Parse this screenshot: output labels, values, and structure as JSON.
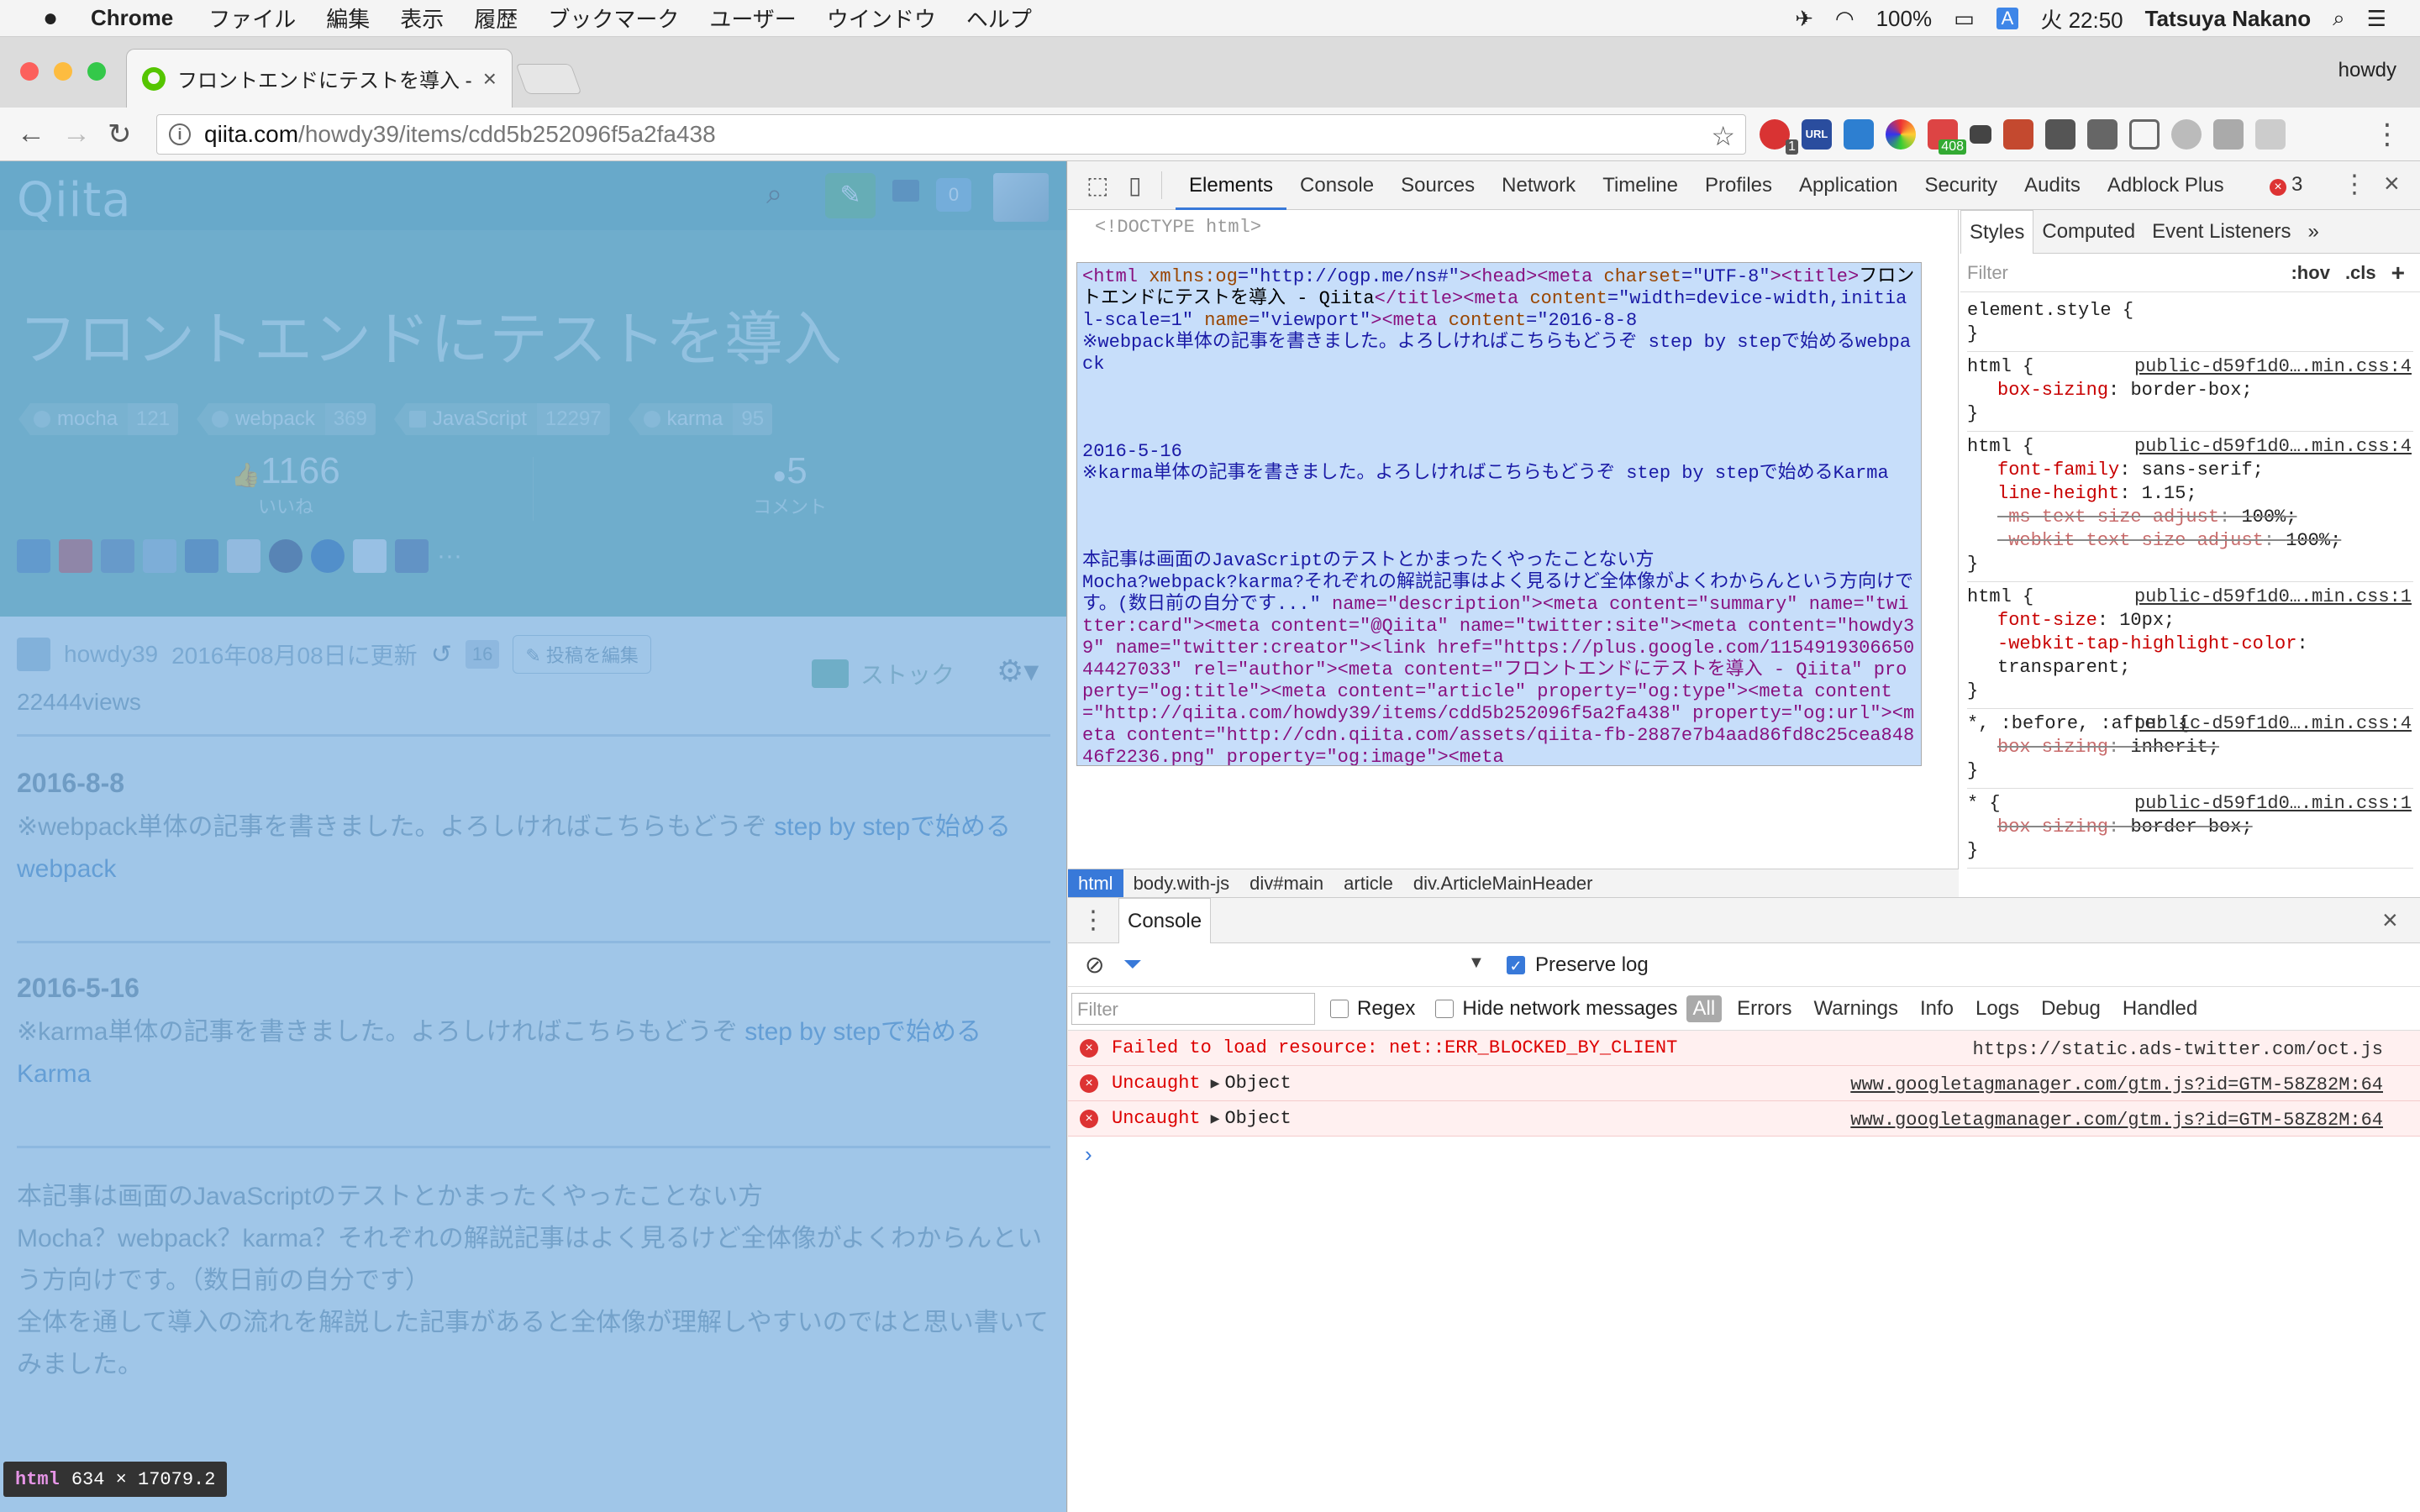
{
  "menubar": {
    "apple": "",
    "app": "Chrome",
    "items": [
      "ファイル",
      "編集",
      "表示",
      "履歴",
      "ブックマーク",
      "ユーザー",
      "ウインドウ",
      "ヘルプ"
    ],
    "battery": "100%",
    "input_mode": "A",
    "clock": "火 22:50",
    "user": "Tatsuya Nakano"
  },
  "browser": {
    "tab_title": "フロントエンドにテストを導入 - Q",
    "profile": "howdy",
    "url_host": "qiita.com",
    "url_path": "/howdy39/items/cdd5b252096f5a2fa438",
    "extension_badge": "408",
    "extension_badge_2": "1",
    "extension_label": "URL"
  },
  "page": {
    "logo": "Qiita",
    "notification_count": "0",
    "title": "フロントエンドにテストを導入",
    "tags": [
      {
        "name": "mocha",
        "count": "121"
      },
      {
        "name": "webpack",
        "count": "369"
      },
      {
        "name": "JavaScript",
        "count": "12297"
      },
      {
        "name": "karma",
        "count": "95"
      }
    ],
    "likes": "1166",
    "likes_label": "いいね",
    "comments": "5",
    "comments_label": "コメント",
    "author": "howdy39",
    "updated": "2016年08月08日に更新",
    "history_count": "16",
    "edit_label": "投稿を編集",
    "stock_label": "ストック",
    "views": "22444views",
    "sec1_date": "2016-8-8",
    "sec1_text": "※webpack単体の記事を書きました。よろしければこちらもどうぞ ",
    "sec1_link": "step by stepで始めるwebpack",
    "sec2_date": "2016-5-16",
    "sec2_text": "※karma単体の記事を書きました。よろしければこちらもどうぞ ",
    "sec2_link": "step by stepで始めるKarma",
    "intro_lines": [
      "本記事は画面のJavaScriptのテストとかまったくやったことない方",
      "Mocha？webpack？karma？それぞれの解説記事はよく見るけど全体像がよくわからんという方向けです。（数日前の自分です）",
      "全体を通して導入の流れを解説した記事があると全体像が理解しやすいのではと思い書いてみました。"
    ],
    "tooltip_tag": "html",
    "tooltip_dims": "634 × 17079.2"
  },
  "devtools": {
    "tabs": [
      "Elements",
      "Console",
      "Sources",
      "Network",
      "Timeline",
      "Profiles",
      "Application",
      "Security",
      "Audits",
      "Adblock Plus"
    ],
    "error_count": "3",
    "doctype": "<!DOCTYPE html>",
    "html_source": {
      "open": "<html ",
      "attr_xmlns": "xmlns:og",
      "attr_xmlns_val": "\"http://ogp.me/ns#\"",
      "head_meta": "><head><meta ",
      "charset_attr": "charset",
      "charset_val": "\"UTF-8\"",
      "title_open": "><title>",
      "title_text": "フロントエンドにテストを導入 - Qiita",
      "title_close": "</title><meta ",
      "content_attr": "content",
      "viewport_val": "\"width=device-width,initial-scale=1\"",
      "name_attr": "name",
      "viewport_name": "\"viewport\"",
      "meta_open": "><meta ",
      "desc_lines": "\"2016-8-8\n※webpack単体の記事を書きました。よろしければこちらもどうぞ step by stepで始めるwebpack\n\n\n\n2016-5-16\n※karma単体の記事を書きました。よろしければこちらもどうぞ step by stepで始めるKarma\n\n\n\n本記事は画面のJavaScriptのテストとかまったくやったことない方\nMocha?webpack?karma?それぞれの解説記事はよく見るけど全体像がよくわからんという方向けです。(数日前の自分です...\"",
      "rest": " name=\"description\"><meta content=\"summary\" name=\"twitter:card\"><meta content=\"@Qiita\" name=\"twitter:site\"><meta content=\"howdy39\" name=\"twitter:creator\"><link href=\"https://plus.google.com/115491930665044427033\" rel=\"author\"><meta content=\"フロントエンドにテストを導入 - Qiita\" property=\"og:title\"><meta content=\"article\" property=\"og:type\"><meta content=\"http://qiita.com/howdy39/items/cdd5b252096f5a2fa438\" property=\"og:url\"><meta content=\"http://cdn.qiita.com/assets/qiita-fb-2887e7b4aad86fd8c25cea84846f2236.png\" property=\"og:image\"><meta"
    },
    "breadcrumbs": [
      "html",
      "body.with-js",
      "div#main",
      "article",
      "div.ArticleMainHeader"
    ],
    "styles_tabs": [
      "Styles",
      "Computed",
      "Event Listeners"
    ],
    "styles_filter": "Filter",
    "hov": ":hov",
    "cls": ".cls",
    "rules": [
      {
        "selector": "element.style {",
        "source": "",
        "decls": []
      },
      {
        "selector": "html {",
        "source": "public-d59f1d0….min.css:4",
        "decls": [
          {
            "p": "box-sizing",
            "v": "border-box;",
            "struck": false
          }
        ]
      },
      {
        "selector": "html {",
        "source": "public-d59f1d0….min.css:4",
        "decls": [
          {
            "p": "font-family",
            "v": "sans-serif;",
            "struck": false
          },
          {
            "p": "line-height",
            "v": "1.15;",
            "struck": false
          },
          {
            "p": "-ms-text-size-adjust",
            "v": "100%;",
            "struck": true
          },
          {
            "p": "-webkit-text-size-adjust",
            "v": "100%;",
            "struck": true
          }
        ]
      },
      {
        "selector": "html {",
        "source": "public-d59f1d0….min.css:1",
        "decls": [
          {
            "p": "font-size",
            "v": "10px;",
            "struck": false
          },
          {
            "p": "-webkit-tap-highlight-color",
            "v": "transparent;",
            "struck": false
          }
        ]
      },
      {
        "selector": "*, :before, :after {",
        "source": "public-d59f1d0….min.css:4",
        "decls": [
          {
            "p": "box-sizing",
            "v": "inherit;",
            "struck": true
          }
        ]
      },
      {
        "selector": "* {",
        "source": "public-d59f1d0….min.css:1",
        "decls": [
          {
            "p": "box-sizing",
            "v": "border-box;",
            "struck": true
          }
        ]
      }
    ],
    "drawer_tab": "Console",
    "preserve_log": "Preserve log",
    "filter_placeholder": "Filter",
    "regex": "Regex",
    "hide_network": "Hide network messages",
    "levels": [
      "All",
      "Errors",
      "Warnings",
      "Info",
      "Logs",
      "Debug",
      "Handled"
    ],
    "messages": [
      {
        "text": "Failed to load resource: net::ERR_BLOCKED_BY_CLIENT",
        "obj": "",
        "src": "https://static.ads-twitter.com/oct.js",
        "link": false
      },
      {
        "text": "Uncaught",
        "obj": "Object",
        "src": "www.googletagmanager.com/gtm.js?id=GTM-58Z82M:64",
        "link": true
      },
      {
        "text": "Uncaught",
        "obj": "Object",
        "src": "www.googletagmanager.com/gtm.js?id=GTM-58Z82M:64",
        "link": true
      }
    ],
    "prompt": "›"
  }
}
